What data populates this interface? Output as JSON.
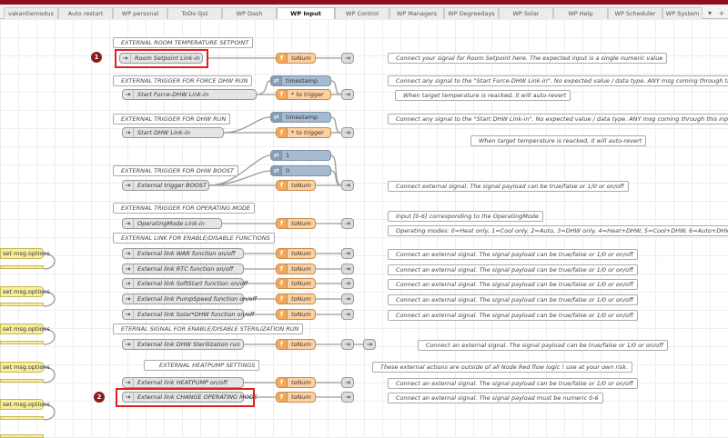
{
  "tabs": [
    "vakantiemodus",
    "Auto restart",
    "WP personal",
    "ToDo lijst",
    "WP Dash",
    "WP Input",
    "WP Control",
    "WP Managers",
    "WP Degreedays",
    "WP Solar",
    "WP Help",
    "WP Scheduler",
    "WP System"
  ],
  "active_tab": "WP Input",
  "tab_menu_icon": "dropdown-icon",
  "tab_add_icon": "plus-icon",
  "colors": {
    "function_node": "#fdd0a2",
    "change_node": "#a6bbcf",
    "link_node": "#dddddd",
    "highlight": "#e02020",
    "badge": "#8b1a1a",
    "top_bar": "#8c101c"
  },
  "badges": [
    "1",
    "2"
  ],
  "fn": {
    "tonum": "toNum",
    "totrigger": "* to trigger",
    "timestamp": "timestamp",
    "one": "1",
    "zero": "0"
  },
  "ext_label": "set msg.options",
  "titles": {
    "room": "EXTERNAL ROOM TEMPERATURE SETPOINT",
    "dhw_force": "EXTERNAL TRIGGER FOR FORCE DHW RUN",
    "dhw_run": "EXTERNAL TRIGGER FOR DHW RUN",
    "dhw_boost": "EXTERNAL TRIGGER FOR DHW BOOST",
    "opmode": "EXTERNAL TRIGGER FOR OPERATING MODE",
    "enable": "EXTERNAL LINK FOR ENABLE/DISABLE FUNCTIONS",
    "steril": "ETERNAL SIGNAL FOR ENABLE/DISABLE STERILIZATION RUN",
    "heatpump": "EXTERNAL HEATPUMP SETTINGS"
  },
  "links": {
    "room": "Room Setpoint Link-in",
    "force": "Start Force-DHW Link-in",
    "dhw": "Start DHW Link-in",
    "boost": "External trigger BOOST",
    "opmode": "OperatingMode Link-in",
    "war": "External link WAR function on/off",
    "rtc": "External link RTC function on/off",
    "softstart": "External link SoftStart function on/off",
    "pumpspeed": "External link PumpSpeed function on/off",
    "solar": "External link Solar*DHW function on/off",
    "steril": "External link DHW Sterilization run",
    "heatpump": "External link HEATPUMP on/off",
    "change_mode": "External link CHANGE OPERATING MODE"
  },
  "notes": {
    "room": "Connect your signal for Room Setpoint here. The expected input is a single numeric value",
    "force": "Connect any signal to the \"Start Force-DHW Link-in\". No expected value / data type. ANY msg coming through this input, will be used.",
    "force_revert": "When target temperature is reacked, it will auto-revert",
    "dhw": "Connect any signal to the \"Start DHW Link-in\". No expected value / data type. ANY msg coming through this input will be used",
    "dhw_revert": "When target temperature is reacked, it will auto-revert",
    "boost": "Connect external signal. The signal payload can be true/false or 1/0 or on/off",
    "opmode_input": "Input [0-6] corresponding to the OperatingMode",
    "opmode_values": "Operating modes: 0=Heat only, 1=Cool only, 2=Auto, 3=DHW only, 4=Heat+DHW, 5=Cool+DHW, 6=Auto+DHW",
    "bool": "Connect an external signal. The signal payload can be true/false or 1/0 or on/off",
    "heatpump_warn": "These external actions are outside of all Node Red flow logic ! use at your own risk.",
    "numeric": "Connect an external signal. The signal payload must be numeric 0-6"
  }
}
